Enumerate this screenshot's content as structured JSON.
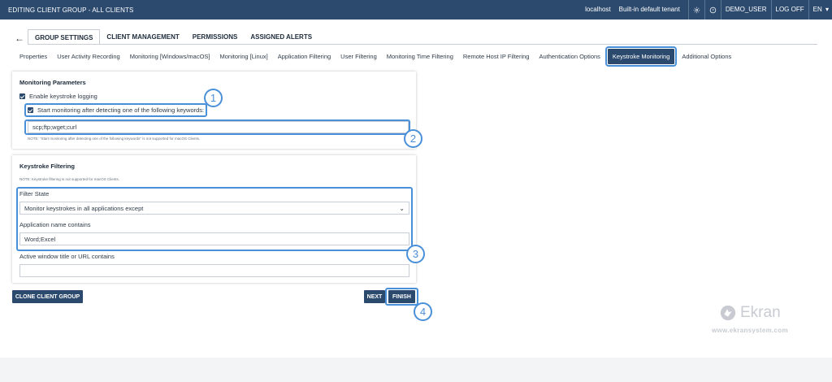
{
  "header": {
    "title": "EDITING CLIENT GROUP - ALL CLIENTS",
    "server": "localhost",
    "tenant": "Built-in default tenant",
    "user": "DEMO_USER",
    "logoff": "LOG OFF",
    "language": "EN",
    "settings_icon": "gear-icon",
    "help_icon": "help-icon",
    "language_icon": "chevron-down-icon"
  },
  "nav": {
    "back_icon": "arrow-left-icon",
    "back_glyph": "←",
    "main_tabs": [
      "GROUP SETTINGS",
      "CLIENT MANAGEMENT",
      "PERMISSIONS",
      "ASSIGNED ALERTS"
    ],
    "sub_tabs": [
      "Properties",
      "User Activity Recording",
      "Monitoring [Windows/macOS]",
      "Monitoring [Linux]",
      "Application Filtering",
      "User Filtering",
      "Monitoring Time Filtering",
      "Remote Host IP Filtering",
      "Authentication Options",
      "Keystroke Monitoring",
      "Additional Options"
    ],
    "active_sub_tab": "Keystroke Monitoring"
  },
  "monitoring": {
    "title": "Monitoring Parameters",
    "enable_logging": "Enable keystroke logging",
    "enable_logging_checked": true,
    "start_after_keywords": "Start monitoring after detecting one of the following keywords:",
    "start_after_keywords_checked": true,
    "keywords_value": "scp;ftp;wget;curl",
    "note": "NOTE: \"Start monitoring after detecting one of the following keywords\" is not supported for macOS Clients."
  },
  "filtering": {
    "title": "Keystroke Filtering",
    "note": "NOTE: Keystroke filtering is not supported for macOS Clients.",
    "filter_state_label": "Filter State",
    "filter_state_value": "Monitor keystrokes in all applications except",
    "app_name_label": "Application name contains",
    "app_name_value": "Word;Excel",
    "window_title_label": "Active window title or URL contains",
    "window_title_value": ""
  },
  "buttons": {
    "clone": "CLONE CLIENT GROUP",
    "next": "NEXT",
    "finish": "FINISH"
  },
  "callouts": [
    "1",
    "2",
    "3",
    "4"
  ],
  "watermark": {
    "brand": "Ekran",
    "url": "www.ekransystem.com"
  },
  "colors": {
    "header_bg": "#2c4a6e",
    "highlight": "#4a90d9",
    "button_bg": "#2c4a6e"
  }
}
